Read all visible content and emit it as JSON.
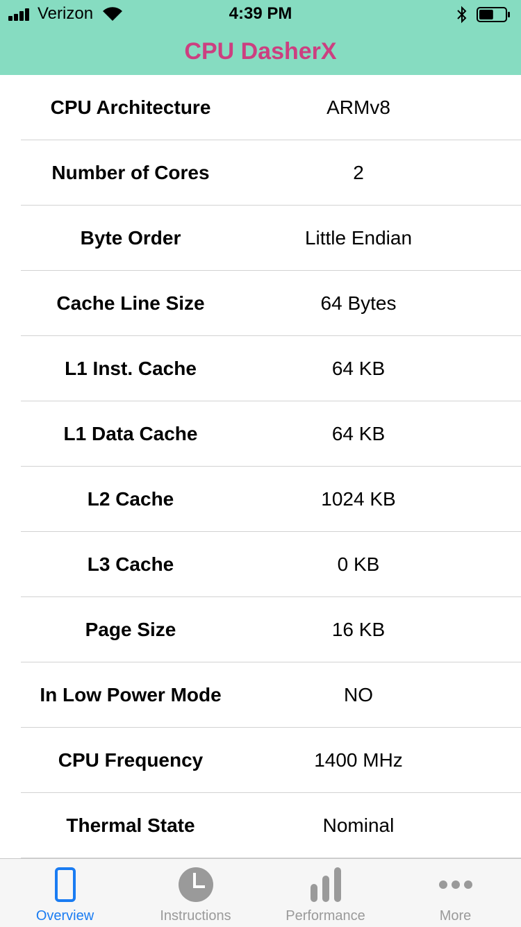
{
  "status_bar": {
    "carrier": "Verizon",
    "time": "4:39 PM",
    "battery_level": 0.55
  },
  "header": {
    "title": "CPU DasherX",
    "background_color": "#86dcc1",
    "title_color": "#cc3f80"
  },
  "rows": [
    {
      "label": "CPU Architecture",
      "value": "ARMv8"
    },
    {
      "label": "Number of Cores",
      "value": "2"
    },
    {
      "label": "Byte Order",
      "value": "Little Endian"
    },
    {
      "label": "Cache Line Size",
      "value": "64 Bytes"
    },
    {
      "label": "L1 Inst. Cache",
      "value": "64 KB"
    },
    {
      "label": "L1 Data Cache",
      "value": "64 KB"
    },
    {
      "label": "L2 Cache",
      "value": "1024 KB"
    },
    {
      "label": "L3 Cache",
      "value": "0 KB"
    },
    {
      "label": "Page Size",
      "value": "16 KB"
    },
    {
      "label": "In Low Power Mode",
      "value": "NO"
    },
    {
      "label": "CPU Frequency",
      "value": "1400 MHz"
    },
    {
      "label": "Thermal State",
      "value": "Nominal"
    }
  ],
  "tabs": [
    {
      "label": "Overview",
      "icon": "phone-icon",
      "active": true
    },
    {
      "label": "Instructions",
      "icon": "clock-icon",
      "active": false
    },
    {
      "label": "Performance",
      "icon": "bar-chart-icon",
      "active": false
    },
    {
      "label": "More",
      "icon": "more-dots-icon",
      "active": false
    }
  ],
  "colors": {
    "accent": "#1a7cf2",
    "inactive_tab": "#9a9a9a"
  }
}
